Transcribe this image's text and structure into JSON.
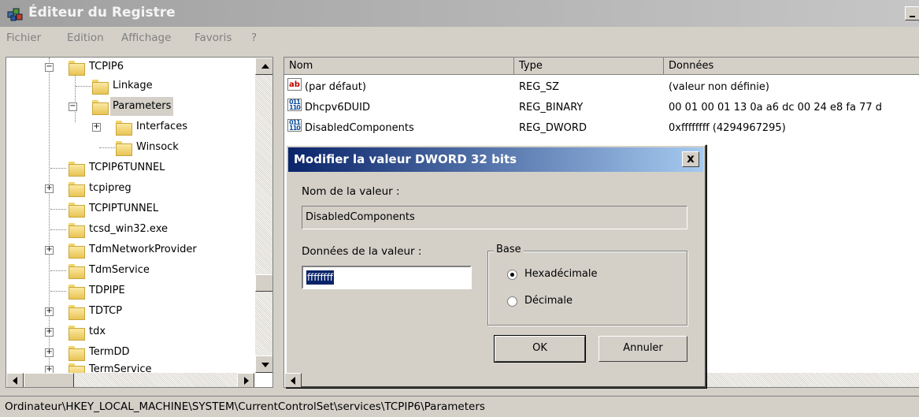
{
  "window": {
    "title": "Éditeur du Registre"
  },
  "menu": [
    "Fichier",
    "Edition",
    "Affichage",
    "Favoris",
    "?"
  ],
  "tree": {
    "items": [
      {
        "label": "TCPIP6",
        "expander": "−"
      },
      {
        "label": "Linkage",
        "expander": ""
      },
      {
        "label": "Parameters",
        "expander": "−"
      },
      {
        "label": "Interfaces",
        "expander": "+"
      },
      {
        "label": "Winsock",
        "expander": ""
      },
      {
        "label": "TCPIP6TUNNEL",
        "expander": ""
      },
      {
        "label": "tcpipreg",
        "expander": "+"
      },
      {
        "label": "TCPIPTUNNEL",
        "expander": ""
      },
      {
        "label": "tcsd_win32.exe",
        "expander": ""
      },
      {
        "label": "TdmNetworkProvider",
        "expander": "+"
      },
      {
        "label": "TdmService",
        "expander": ""
      },
      {
        "label": "TDPIPE",
        "expander": ""
      },
      {
        "label": "TDTCP",
        "expander": "+"
      },
      {
        "label": "tdx",
        "expander": "+"
      },
      {
        "label": "TermDD",
        "expander": "+"
      },
      {
        "label": "TermService",
        "expander": "+"
      }
    ],
    "selected": "Parameters"
  },
  "list": {
    "columns": [
      "Nom",
      "Type",
      "Données"
    ],
    "rows": [
      {
        "icon": "string-value-icon",
        "name": "(par défaut)",
        "type": "REG_SZ",
        "data": "(valeur non définie)"
      },
      {
        "icon": "binary-value-icon",
        "name": "Dhcpv6DUID",
        "type": "REG_BINARY",
        "data": "00 01 00 01 13 0a a6 dc 00 24 e8 fa 77 d"
      },
      {
        "icon": "binary-value-icon",
        "name": "DisabledComponents",
        "type": "REG_DWORD",
        "data": "0xffffffff (4294967295)"
      }
    ]
  },
  "dialog": {
    "title": "Modifier la valeur DWORD 32 bits",
    "close_label": "x",
    "name_label": "Nom de la valeur :",
    "name_value": "DisabledComponents",
    "data_label": "Données de la valeur :",
    "data_value": "ffffffff",
    "base_label": "Base",
    "radio_hex": "Hexadécimale",
    "radio_dec": "Décimale",
    "selected_base": "hex",
    "ok_label": "OK",
    "cancel_label": "Annuler"
  },
  "status": {
    "path": "Ordinateur\\HKEY_LOCAL_MACHINE\\SYSTEM\\CurrentControlSet\\services\\TCPIP6\\Parameters"
  }
}
